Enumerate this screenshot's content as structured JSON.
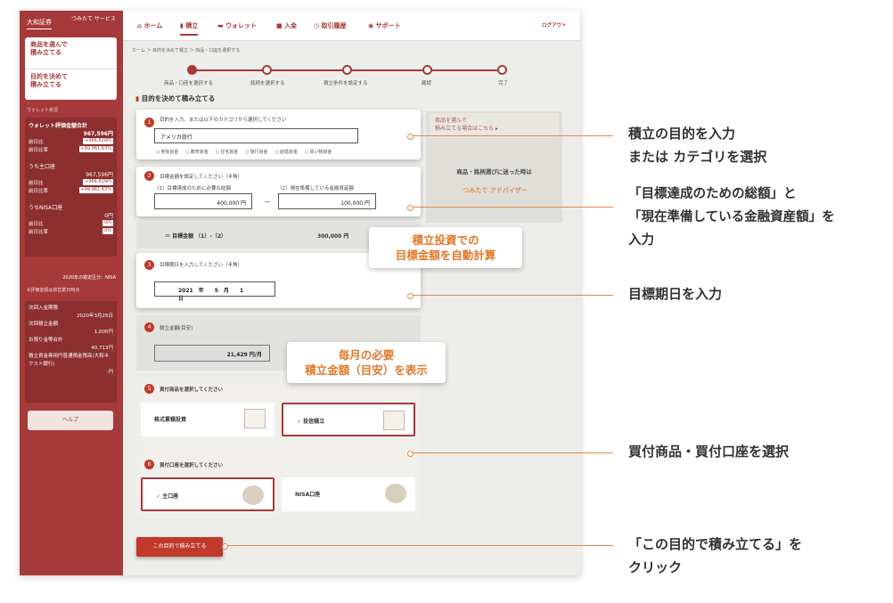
{
  "brand": {
    "company": "大和証券",
    "service": "つみたて サービス"
  },
  "side_menu": {
    "item1": "商品を選んで\n積み立てる",
    "item2": "目的を決めて\n積み立てる"
  },
  "wallet": {
    "label": "ウォレット状況",
    "total_label": "ウォレット評価金額合計",
    "total_value": "967,596円",
    "day_label": "前日比",
    "day_value": "+966,629円",
    "dayrate_label": "前日比率",
    "dayrate_value": "+99,961.63%",
    "main_label": "うち主口座",
    "main_value": "967,596円",
    "main_day": "+966,629円",
    "main_rate": "+99,961.63%",
    "nisa_label": "うちNISA口座",
    "nisa_value": "0円",
    "nisa_day": "0円",
    "nisa_rate": "0%",
    "nisa_note": "2020年の勘定区分：NISA",
    "note": "※評価金額は前営業日時点",
    "next_label": "次回入金期限",
    "next_value": "2020年3月25日",
    "next_amount_label": "次回積立金額",
    "next_amount": "1,000円",
    "deposit_label": "お預り金等合計",
    "deposit_value": "40,713円",
    "balance_label": "積立資金専用円普通預金残高(大和ネクスト銀行)",
    "balance_value": "-円",
    "help": "ヘルプ"
  },
  "nav": {
    "home": "ホーム",
    "tsumitate": "積立",
    "wallet": "ウォレット",
    "deposit": "入金",
    "history": "取引履歴",
    "support": "サポート",
    "logout": "ログアウト"
  },
  "breadcrumb": "ホーム ＞ 目的を決めて積立 ＞ 商品・口座を選択する",
  "steps": [
    "商品・口座を選択する",
    "銘柄を選択する",
    "積立条件を設定する",
    "確認",
    "完了"
  ],
  "section_title": "目的を決めて積み立てる",
  "q1": {
    "num": "1",
    "title": "目的を入力、または以下のカテゴリから選択してください",
    "value": "アメリカ旅行",
    "cats": [
      "老後資金",
      "教育資金",
      "住宅資金",
      "旅行資金",
      "結婚資金",
      "買い物資金"
    ]
  },
  "q2": {
    "num": "2",
    "title": "目標金額を設定してください（半角）",
    "sub1": "（1）目標達成のために必要な総額",
    "val1": "400,000 円",
    "sub2": "（2）現在準備している金融資産額",
    "val2": "100,000 円",
    "minus": "－"
  },
  "goal": {
    "label": "＝ 目標金額 （1）-（2）",
    "value": "300,000 円"
  },
  "q3": {
    "num": "3",
    "title": "目標期日を入力してください（半角）",
    "value": "2021　年　　5　月　　1　日"
  },
  "q4": {
    "num": "4",
    "title": "積立金額(目安)",
    "value": "21,429 円/月"
  },
  "q5": {
    "num": "5",
    "title": "買付商品を選択してください",
    "opt1": "株式累積投資",
    "opt2": "投信積立",
    "check": "✓"
  },
  "q6": {
    "num": "6",
    "title": "買付口座を選択してください",
    "opt1": "主口座",
    "opt2": "NISA口座"
  },
  "submit": "この目的で積み立てる",
  "right_panel": {
    "link": "商品を選んで\n積み立てる場合はこちら ▸",
    "prompt": "商品・銘柄選びに迷った時は",
    "advisor": "つみたて アドバイザー"
  },
  "callouts": {
    "auto": "積立投資での\n目標金額を自動計算",
    "monthly": "毎月の必要\n積立金額（目安）を表示"
  },
  "annotations": [
    "積立の目的を入力\nまたは カテゴリを選択",
    "「目標達成のための総額」と\n「現在準備している金融資産額」を\n入力",
    "目標期日を入力",
    "買付商品・買付口座を選択",
    "「この目的で積み立てる」を\nクリック"
  ],
  "colors": {
    "brand": "#a63a3a",
    "accent": "#e0792b"
  }
}
